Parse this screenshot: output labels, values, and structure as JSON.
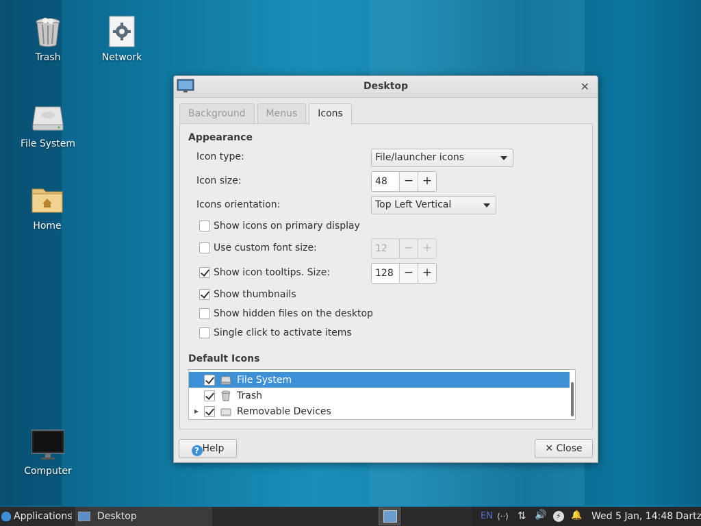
{
  "desktop": {
    "icons": [
      {
        "label": "Trash"
      },
      {
        "label": "Network"
      },
      {
        "label": "File System"
      },
      {
        "label": "Home"
      },
      {
        "label": "Computer"
      }
    ]
  },
  "window": {
    "title": "Desktop",
    "tabs": [
      {
        "label": "Background",
        "active": false
      },
      {
        "label": "Menus",
        "active": false
      },
      {
        "label": "Icons",
        "active": true
      }
    ],
    "appearance": {
      "heading": "Appearance",
      "icon_type_label": "Icon type:",
      "icon_type_value": "File/launcher icons",
      "icon_size_label": "Icon size:",
      "icon_size_value": "48",
      "orientation_label": "Icons orientation:",
      "orientation_value": "Top Left Vertical",
      "show_primary_label": "Show icons on primary display",
      "custom_font_label": "Use custom font size:",
      "custom_font_value": "12",
      "tooltips_label": "Show icon tooltips. Size:",
      "tooltips_value": "128",
      "thumbnails_label": "Show thumbnails",
      "hidden_label": "Show hidden files on the desktop",
      "single_click_label": "Single click to activate items"
    },
    "default_icons": {
      "heading": "Default Icons",
      "items": [
        {
          "label": "File System",
          "checked": true,
          "selected": true
        },
        {
          "label": "Trash",
          "checked": true,
          "selected": false
        },
        {
          "label": "Removable Devices",
          "checked": true,
          "selected": false
        }
      ]
    },
    "buttons": {
      "help": "Help",
      "close": "Close"
    }
  },
  "taskbar": {
    "applications": "Applications",
    "task": "Desktop",
    "keyboard": "EN",
    "clock": "Wed  5 Jan, 14:48",
    "user": "Dartz"
  },
  "colors": {
    "selection": "#3d8fd6",
    "taskbar": "#2b2b2b"
  }
}
